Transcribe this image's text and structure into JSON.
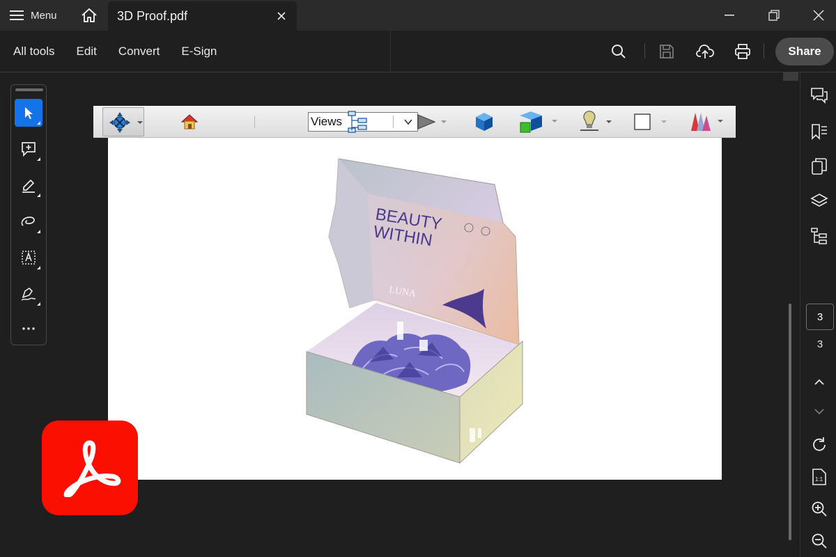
{
  "titlebar": {
    "menu_label": "Menu",
    "document_tab": "3D Proof.pdf"
  },
  "toolbar": {
    "tabs": [
      "All tools",
      "Edit",
      "Convert",
      "E-Sign"
    ],
    "share_label": "Share"
  },
  "toolbar3d": {
    "views_selected": "Views"
  },
  "product": {
    "brand_line1": "BEAUTY",
    "brand_line2": "WITHIN",
    "logo_text": "LUNA"
  },
  "right_rail": {
    "current_page": "3",
    "total_pages": "3"
  },
  "colors": {
    "accent": "#1473e6",
    "acrobat_red": "#fa0f00",
    "background": "#1f1f1f",
    "titlebar": "#2b2b2b"
  },
  "icons": {
    "left_palette": [
      "select-icon",
      "add-comment-icon",
      "highlight-icon",
      "draw-icon",
      "text-select-icon",
      "sign-icon",
      "more-icon"
    ],
    "right_rail": [
      "comments-icon",
      "bookmarks-icon",
      "pages-icon",
      "layers-icon",
      "structure-icon",
      "refresh-icon",
      "fit-page-icon",
      "zoom-in-icon",
      "zoom-out-icon"
    ]
  }
}
